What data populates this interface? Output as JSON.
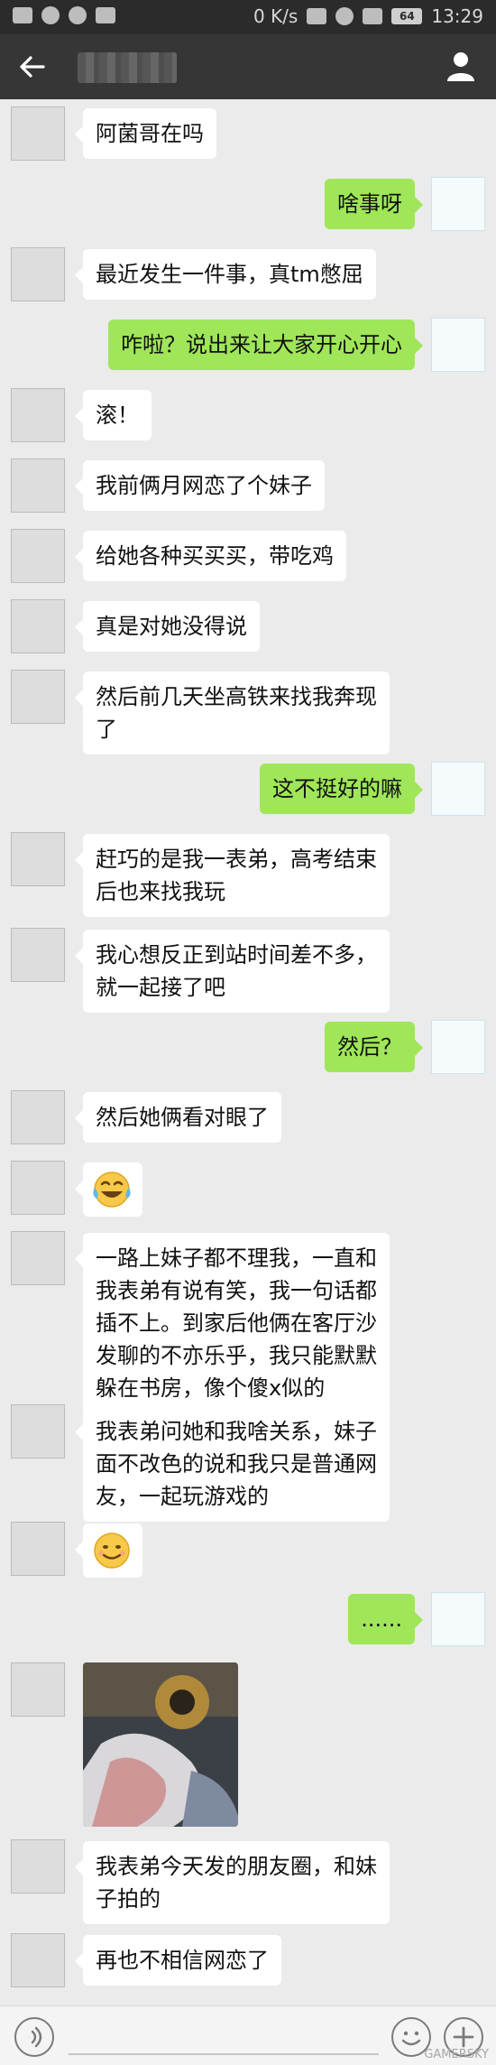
{
  "status_bar": {
    "network_speed": "0 K/s",
    "battery": "64",
    "time": "13:29"
  },
  "header": {
    "back_icon": "arrow-left-icon",
    "profile_icon": "person-icon"
  },
  "messages": [
    {
      "side": "in",
      "text": "阿菌哥在吗"
    },
    {
      "side": "out",
      "text": "啥事呀"
    },
    {
      "side": "in",
      "text": "最近发生一件事，真tm憋屈"
    },
    {
      "side": "out",
      "text": "咋啦？说出来让大家开心开心"
    },
    {
      "side": "in",
      "text": "滚！"
    },
    {
      "side": "in",
      "text": "我前俩月网恋了个妹子"
    },
    {
      "side": "in",
      "text": "给她各种买买买，带吃鸡"
    },
    {
      "side": "in",
      "text": "真是对她没得说"
    },
    {
      "side": "in",
      "text": "然后前几天坐高铁来找我奔现"
    },
    {
      "side": "in",
      "text": "了"
    },
    {
      "side": "out",
      "text": "这不挺好的嘛"
    },
    {
      "side": "in",
      "text": "赶巧的是我一表弟，高考结束"
    },
    {
      "side": "in",
      "text": "后也来找我玩"
    },
    {
      "side": "in",
      "text": "我心想反正到站时间差不多，"
    },
    {
      "side": "in",
      "text": "就一起接了吧"
    },
    {
      "side": "out",
      "text": "然后？"
    },
    {
      "side": "in",
      "text": "然后她俩看对眼了"
    },
    {
      "side": "in",
      "emoji": "laugh-cry-emoji"
    },
    {
      "side": "in",
      "text": "一路上妹子都不理我，一直和"
    },
    {
      "side": "in",
      "text": "我表弟有说有笑，我一句话都"
    },
    {
      "side": "in",
      "text": "插不上。到家后他俩在客厅沙"
    },
    {
      "side": "in",
      "text": "发聊的不亦乐乎，我只能默默"
    },
    {
      "side": "in",
      "text": "躲在书房，像个傻x似的"
    },
    {
      "side": "in",
      "text": "我表弟问她和我啥关系，妹子"
    },
    {
      "side": "in",
      "text": "面不改色的说和我只是普通网"
    },
    {
      "side": "in",
      "text": "友，一起玩游戏的"
    },
    {
      "side": "in",
      "emoji": "smile-emoji"
    },
    {
      "side": "out",
      "text": "......"
    },
    {
      "side": "in",
      "image": "photo-thumbnail"
    },
    {
      "side": "in",
      "text": "我表弟今天发的朋友圈，和妹"
    },
    {
      "side": "in",
      "text": "子拍的"
    },
    {
      "side": "in",
      "text": "再也不相信网恋了"
    }
  ],
  "watermark": "GAMERSKY",
  "colors": {
    "status_bg": "#2b2b2b",
    "title_bg": "#363636",
    "chat_bg": "#ebebeb",
    "out_bubble": "#9fe658",
    "in_bubble": "#ffffff"
  }
}
